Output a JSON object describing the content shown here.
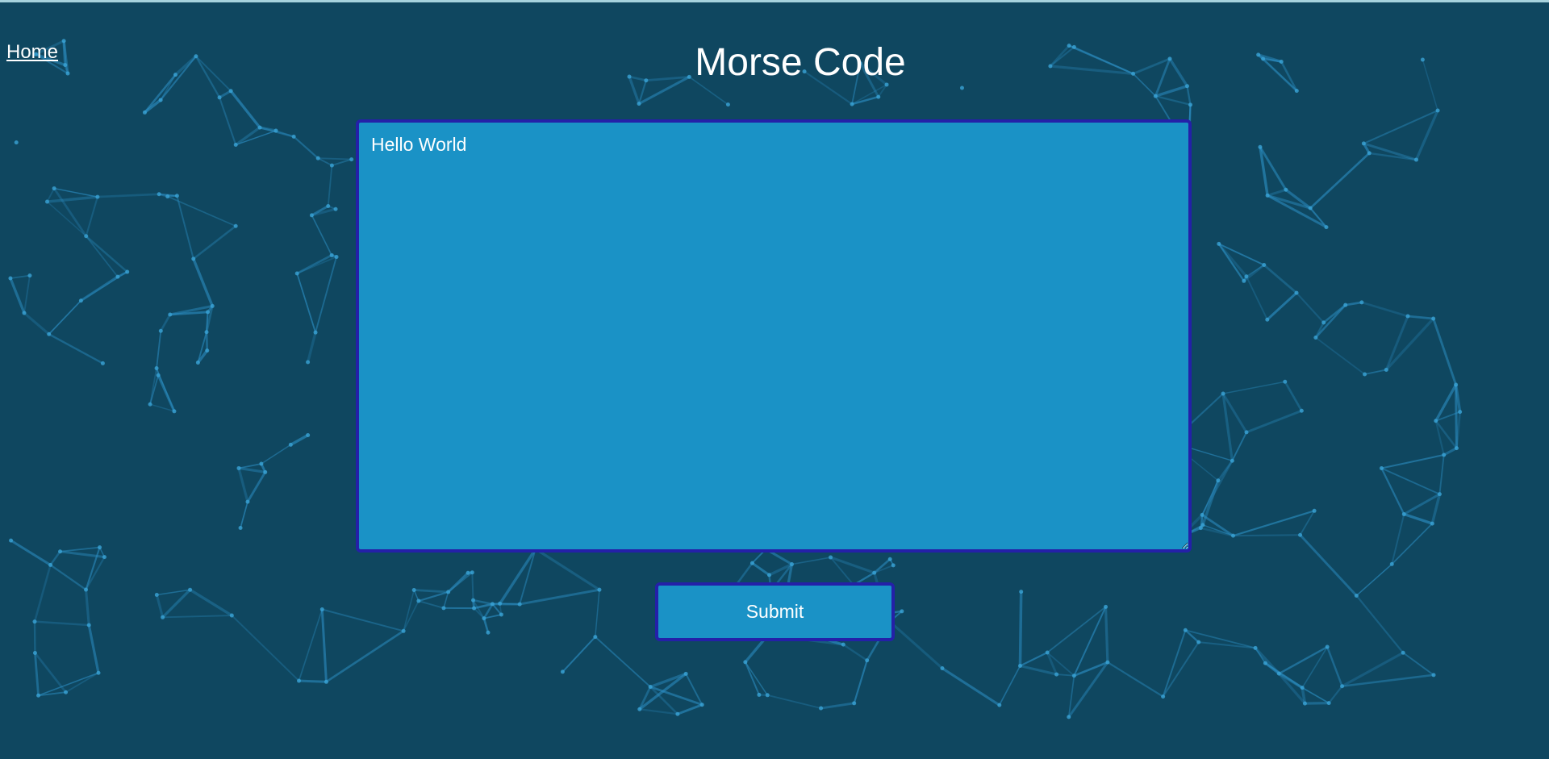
{
  "page": {
    "title": "Morse Code"
  },
  "nav": {
    "home_label": "Home"
  },
  "editor": {
    "value": "Hello World"
  },
  "actions": {
    "submit_label": "Submit"
  },
  "colors": {
    "background": "#0f4760",
    "panel": "#1a92c6",
    "border": "#2420a8",
    "network_lines": "#2c8fc4",
    "text": "#ffffff"
  }
}
